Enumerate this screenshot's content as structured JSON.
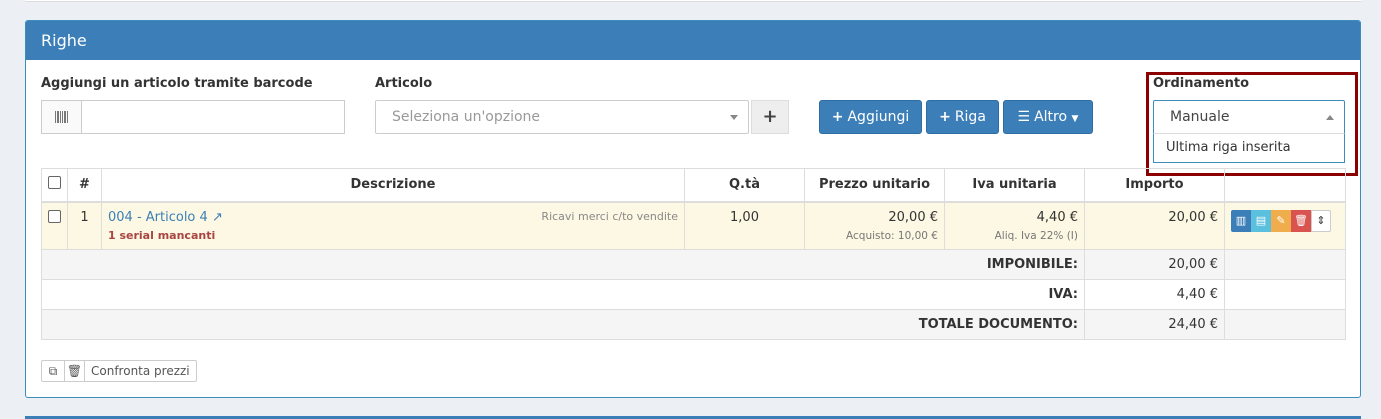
{
  "panel": {
    "title": "Righe"
  },
  "barcode": {
    "label": "Aggiungi un articolo tramite barcode",
    "value": "",
    "icon": "barcode-icon"
  },
  "articolo": {
    "label": "Articolo",
    "placeholder": "Seleziona un'opzione",
    "add_icon": "plus-icon"
  },
  "buttons": {
    "aggiungi": {
      "label": "Aggiungi",
      "icon": "+"
    },
    "riga": {
      "label": "Riga",
      "icon": "+"
    },
    "altro": {
      "label": "Altro",
      "icon": "☰"
    }
  },
  "ordinamento": {
    "label": "Ordinamento",
    "selected": "Manuale",
    "options": [
      "Ultima riga inserita"
    ]
  },
  "table": {
    "headers": {
      "num": "#",
      "descrizione": "Descrizione",
      "qta": "Q.tà",
      "prezzo": "Prezzo unitario",
      "iva": "Iva unitaria",
      "importo": "Importo"
    },
    "rows": [
      {
        "num": "1",
        "descrizione": "004 - Articolo 4",
        "conto": "Ricavi merci c/to vendite",
        "warning": "1 serial mancanti",
        "qta": "1,00",
        "prezzo": "20,00 €",
        "acquisto": "Acquisto: 10,00 €",
        "iva": "4,40 €",
        "aliquota": "Aliq. Iva 22% (I)",
        "importo": "20,00 €"
      }
    ],
    "totals": {
      "imponibile_label": "IMPONIBILE:",
      "imponibile": "20,00 €",
      "iva_label": "IVA:",
      "iva": "4,40 €",
      "totale_label": "TOTALE DOCUMENTO:",
      "totale": "24,40 €"
    }
  },
  "footer": {
    "confronta_label": "Confronta prezzi"
  },
  "colors": {
    "primary": "#3c7fb8",
    "highlight": "#8b0000",
    "row_bg": "#fcf8e3"
  }
}
